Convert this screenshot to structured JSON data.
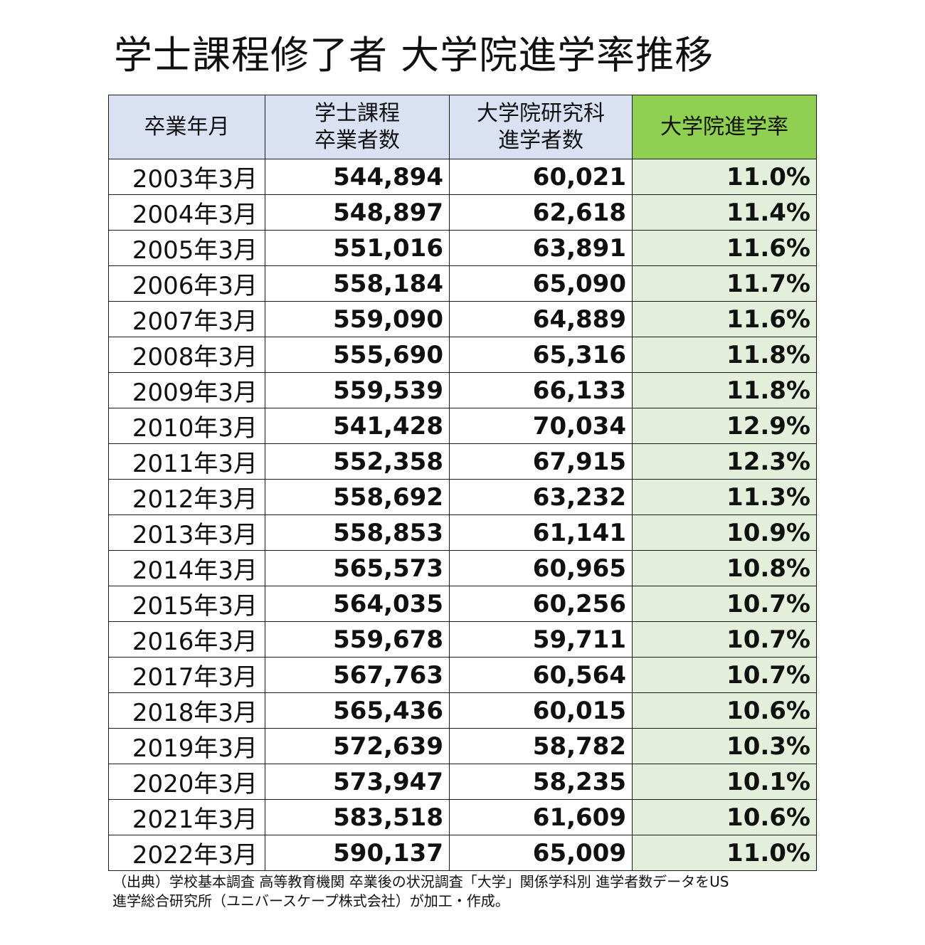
{
  "chart_data": {
    "type": "table",
    "title": "学士課程修了者 大学院進学率推移",
    "columns": [
      {
        "lines": [
          "卒業年月"
        ]
      },
      {
        "lines": [
          "学士課程",
          "卒業者数"
        ]
      },
      {
        "lines": [
          "大学院研究科",
          "進学者数"
        ]
      },
      {
        "lines": [
          "大学院進学率"
        ]
      }
    ],
    "rows": [
      [
        "2003年3月",
        "544,894",
        "60,021",
        "11.0%"
      ],
      [
        "2004年3月",
        "548,897",
        "62,618",
        "11.4%"
      ],
      [
        "2005年3月",
        "551,016",
        "63,891",
        "11.6%"
      ],
      [
        "2006年3月",
        "558,184",
        "65,090",
        "11.7%"
      ],
      [
        "2007年3月",
        "559,090",
        "64,889",
        "11.6%"
      ],
      [
        "2008年3月",
        "555,690",
        "65,316",
        "11.8%"
      ],
      [
        "2009年3月",
        "559,539",
        "66,133",
        "11.8%"
      ],
      [
        "2010年3月",
        "541,428",
        "70,034",
        "12.9%"
      ],
      [
        "2011年3月",
        "552,358",
        "67,915",
        "12.3%"
      ],
      [
        "2012年3月",
        "558,692",
        "63,232",
        "11.3%"
      ],
      [
        "2013年3月",
        "558,853",
        "61,141",
        "10.9%"
      ],
      [
        "2014年3月",
        "565,573",
        "60,965",
        "10.8%"
      ],
      [
        "2015年3月",
        "564,035",
        "60,256",
        "10.7%"
      ],
      [
        "2016年3月",
        "559,678",
        "59,711",
        "10.7%"
      ],
      [
        "2017年3月",
        "567,763",
        "60,564",
        "10.7%"
      ],
      [
        "2018年3月",
        "565,436",
        "60,015",
        "10.6%"
      ],
      [
        "2019年3月",
        "572,639",
        "58,782",
        "10.3%"
      ],
      [
        "2020年3月",
        "573,947",
        "58,235",
        "10.1%"
      ],
      [
        "2021年3月",
        "583,518",
        "61,609",
        "10.6%"
      ],
      [
        "2022年3月",
        "590,137",
        "65,009",
        "11.0%"
      ]
    ]
  },
  "source_note": {
    "line1": "（出典）学校基本調査 高等教育機関 卒業後の状況調査「大学」関係学科別 進学者数データをUS",
    "line2": "進学総合研究所（ユニバースケープ株式会社）が加工・作成。"
  },
  "colors": {
    "header_bg": "#dae1f2",
    "rate_header_bg": "#8fcf52",
    "rate_cell_bg": "#e3efdb"
  }
}
